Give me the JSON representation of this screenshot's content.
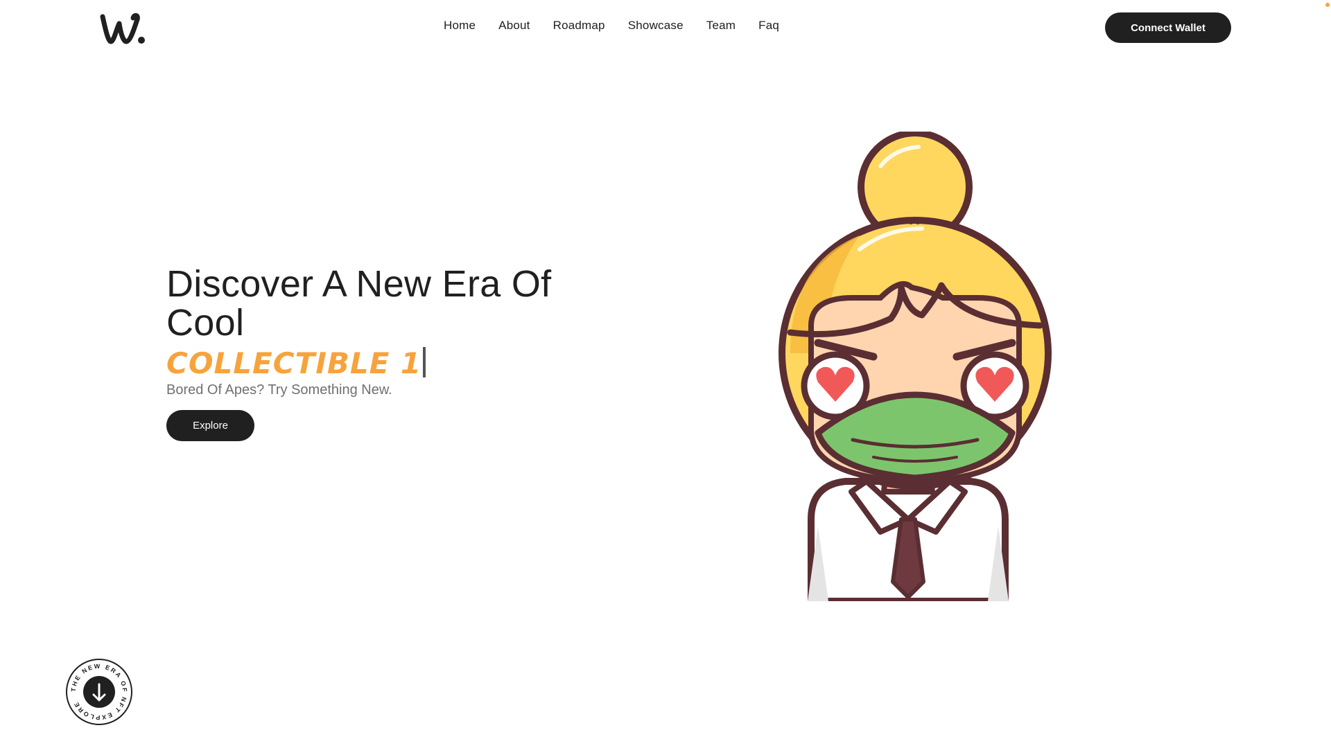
{
  "header": {
    "logo_text": "w.",
    "nav": [
      {
        "label": "Home"
      },
      {
        "label": "About"
      },
      {
        "label": "Roadmap"
      },
      {
        "label": "Showcase"
      },
      {
        "label": "Team"
      },
      {
        "label": "Faq"
      }
    ],
    "connect_label": "Connect Wallet"
  },
  "hero": {
    "title": "Discover A New Era Of Cool",
    "typing_text": "COLLECTIBLE 1",
    "subtitle": "Bored Of Apes? Try Something New.",
    "explore_label": "Explore"
  },
  "badge": {
    "ring_text": "THE NEW ERA OF NFT EXPLORE",
    "icon": "arrow-down-icon"
  },
  "colors": {
    "dark": "#202020",
    "accent": "#f7a33c",
    "subtitle": "#707070",
    "hair": "#ffd75e",
    "mask": "#7dc56d",
    "outline": "#5a2e32",
    "heart": "#f15858"
  }
}
